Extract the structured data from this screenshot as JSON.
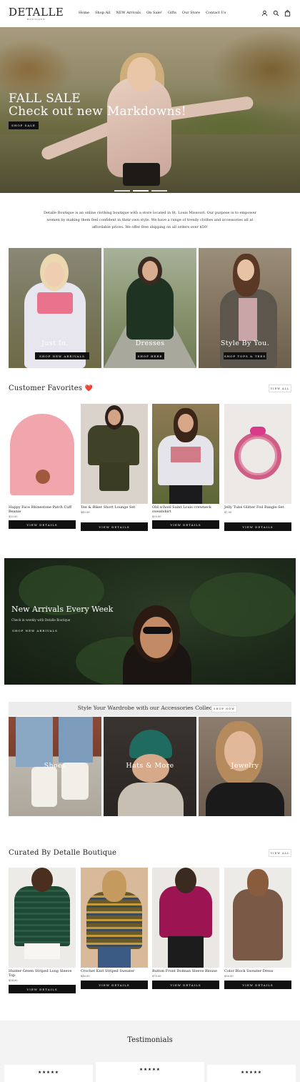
{
  "header": {
    "logo": "DETALLE",
    "logo_sub": "BOUTIQUE",
    "nav": [
      "Home",
      "Shop All",
      "NEW Arrivals",
      "On Sale!",
      "Gifts",
      "Our Store",
      "Contact Us"
    ],
    "icons": [
      "user-icon",
      "search-icon",
      "bag-icon"
    ]
  },
  "hero": {
    "title_line1": "FALL SALE",
    "title_line2": "Check out new Markdowns!",
    "button": "SHOP SALE"
  },
  "intro": "Detalle Boutique is an online clothing boutique with a store located in St. Louis Missouri. Our purpose is to empower women by making them feel confident in their own style. We have a range of trendy clothes and accessories all at affordable prices. We offer free shipping on all orders over $50!",
  "categories": [
    {
      "label": "Just In.",
      "button": "SHOP NEW ARRIVALS"
    },
    {
      "label": "Dresses",
      "button": "SHOP HERE"
    },
    {
      "label": "Style By You.",
      "button": "SHOP TOPS & TEES"
    }
  ],
  "favorites": {
    "title": "Customer Favorites",
    "emoji": "❤️",
    "view_all": "VIEW ALL",
    "products": [
      {
        "name": "Happy Face Rhinestone Patch Cuff Beanie",
        "price": "$20.00",
        "button": "VIEW DETAILS"
      },
      {
        "name": "Tee & Biker Short Lounge Set",
        "price": "$40.00",
        "button": "VIEW DETAILS"
      },
      {
        "name": "Old school Saint Louis crewneck sweatshirt",
        "price": "$30.00",
        "button": "VIEW DETAILS"
      },
      {
        "name": "Jelly Tube Glitter Foil Bangle Set",
        "price": "$7.00",
        "button": "VIEW DETAILS"
      }
    ]
  },
  "new_arrivals": {
    "title": "New Arrivals Every Week",
    "subtitle": "Check in weekly with Detalle Boutique",
    "button": "SHOP NEW ARRIVALS"
  },
  "accessories": {
    "title": "Style Your Wardrobe with our Accessories Collection",
    "button": "SHOP NOW",
    "tiles": [
      "Shoes",
      "Hats & More",
      "Jewelry"
    ]
  },
  "curated": {
    "title": "Curated By Detalle Boutique",
    "view_all": "VIEW ALL",
    "products": [
      {
        "name": "Hunter Green Striped Long Sleeve Top",
        "price": "$34.00",
        "button": "VIEW DETAILS"
      },
      {
        "name": "Crochet Knit Striped Sweater",
        "price": "$46.00",
        "button": "VIEW DETAILS"
      },
      {
        "name": "Button Front Dolman Sleeve Blouse",
        "price": "$75.00",
        "button": "VIEW DETAILS"
      },
      {
        "name": "Color Block Sweater Dress",
        "price": "$56.00",
        "button": "VIEW DETAILS"
      }
    ]
  },
  "testimonials": {
    "title": "Testimonials",
    "stars": [
      "★★★★★",
      "★★★★★",
      "★★★★★"
    ]
  },
  "colors": {
    "accent_dark": "#111111",
    "text": "#1c1d1d",
    "banner_gray": "#ececec",
    "testimonial_bg": "#f3f3f3"
  }
}
